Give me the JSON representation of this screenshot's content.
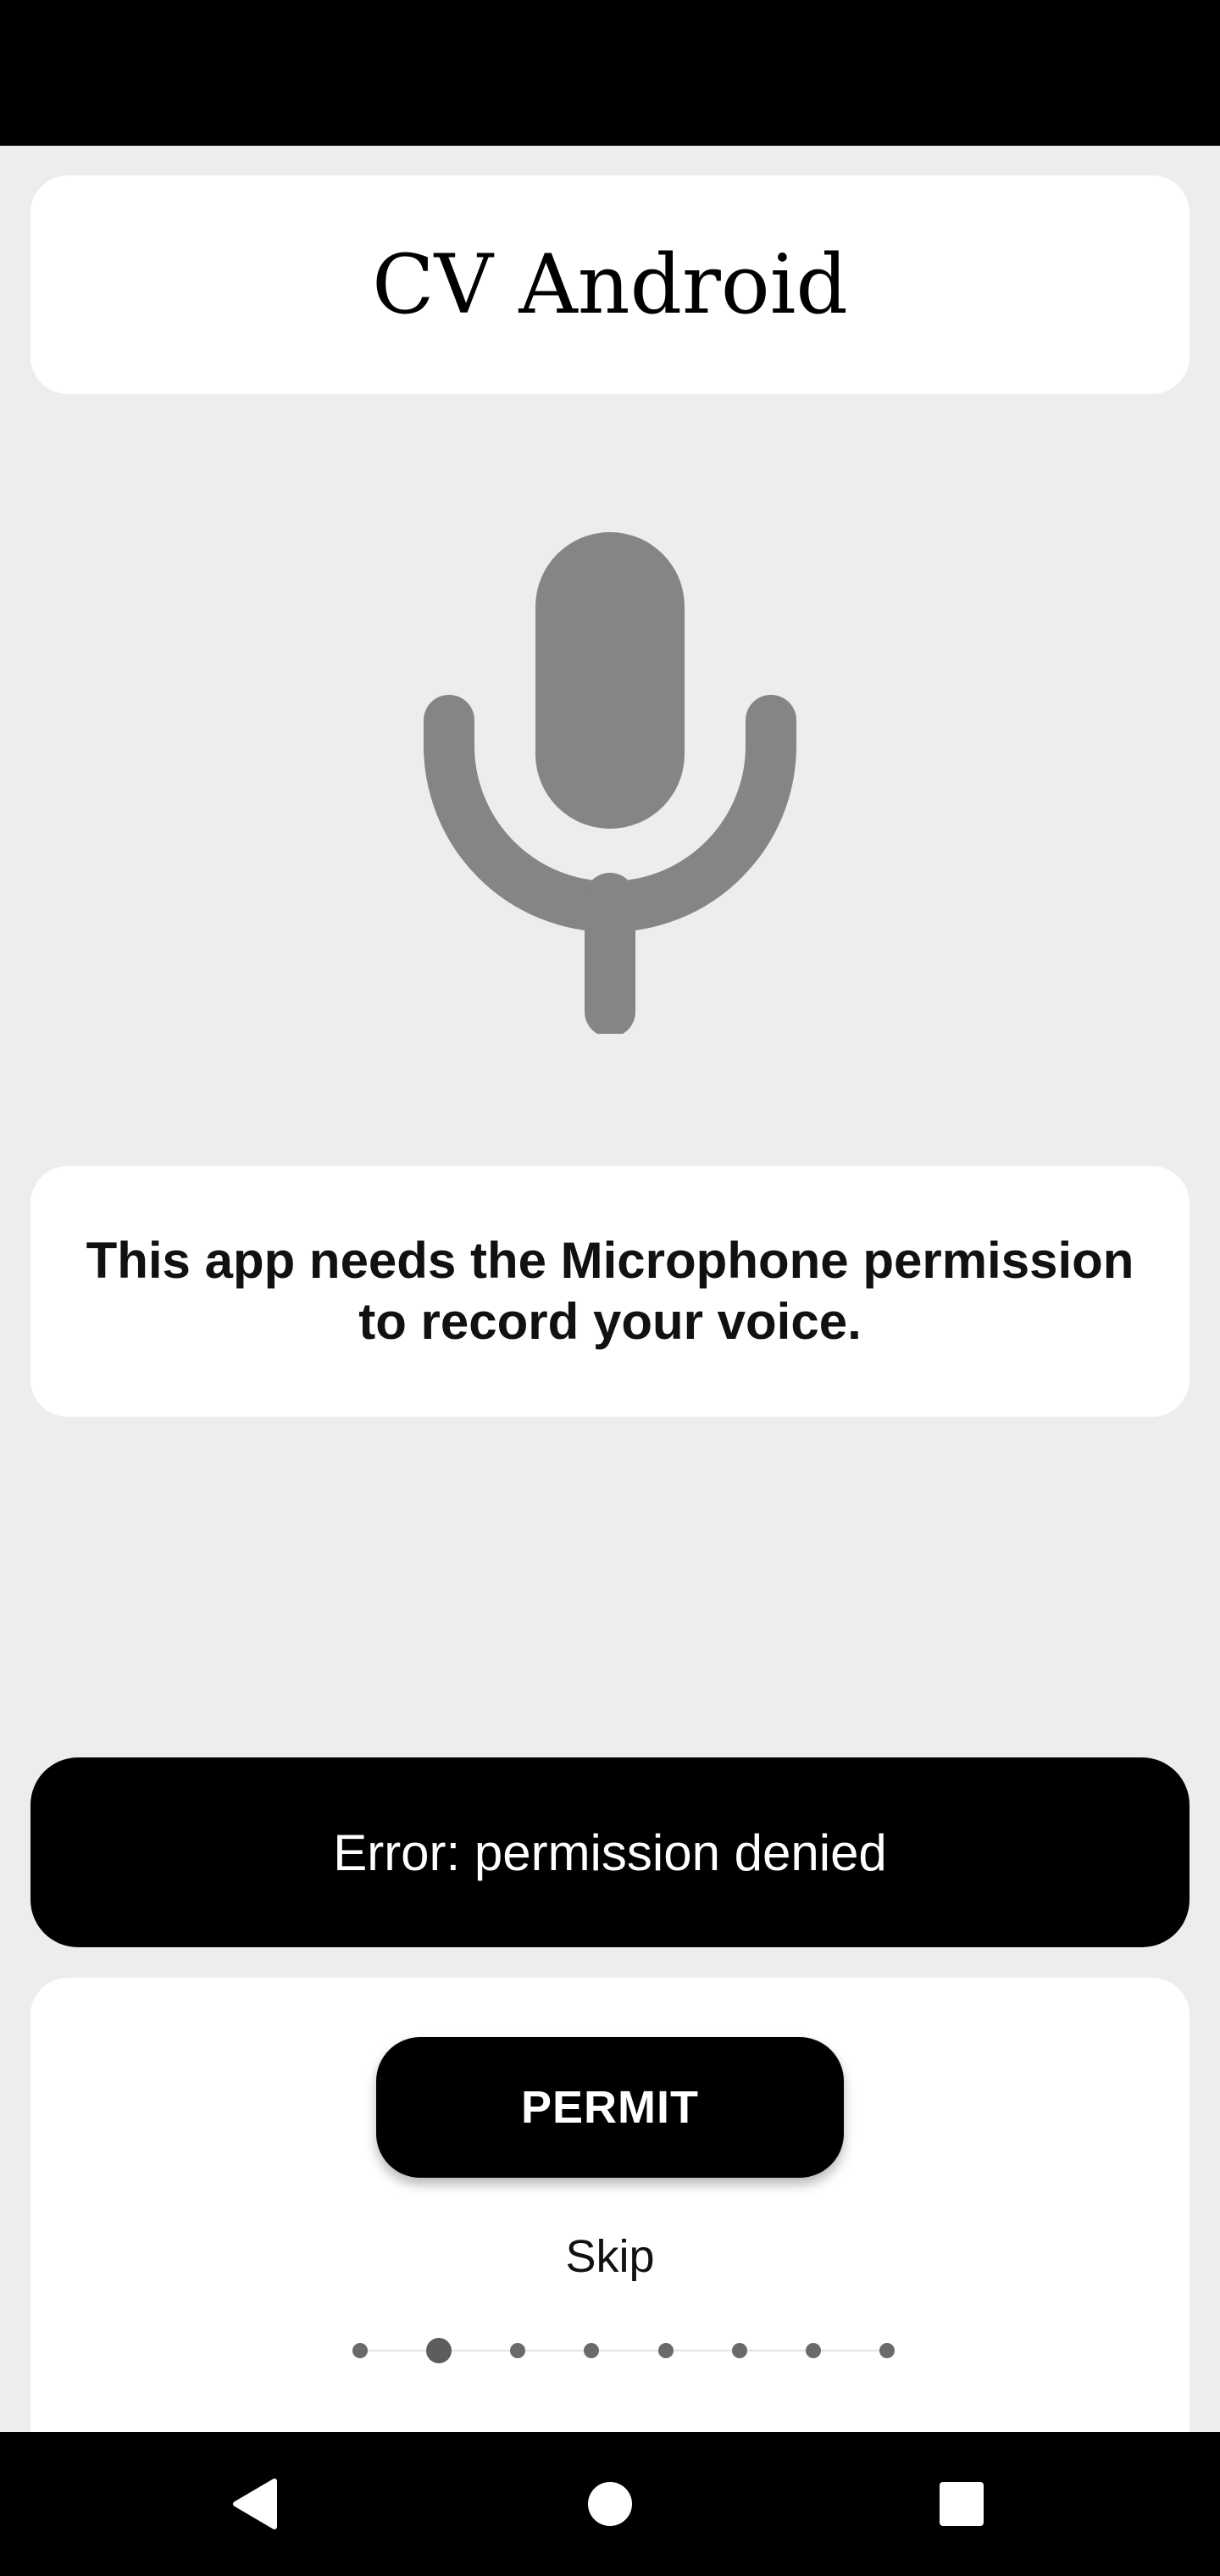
{
  "app": {
    "title": "CV Android"
  },
  "permission": {
    "icon": "microphone-icon",
    "message": "This app needs the Microphone permission to record your voice."
  },
  "error": {
    "text": "Error: permission denied"
  },
  "actions": {
    "permit_label": "PERMIT",
    "skip_label": "Skip"
  },
  "pager": {
    "total": 8,
    "active_index": 1
  },
  "nav": {
    "back_icon": "back-triangle-icon",
    "home_icon": "home-circle-icon",
    "recents_icon": "recents-square-icon"
  },
  "colors": {
    "background": "#ededed",
    "card": "#ffffff",
    "accent": "#000000",
    "icon_gray": "#858585"
  }
}
